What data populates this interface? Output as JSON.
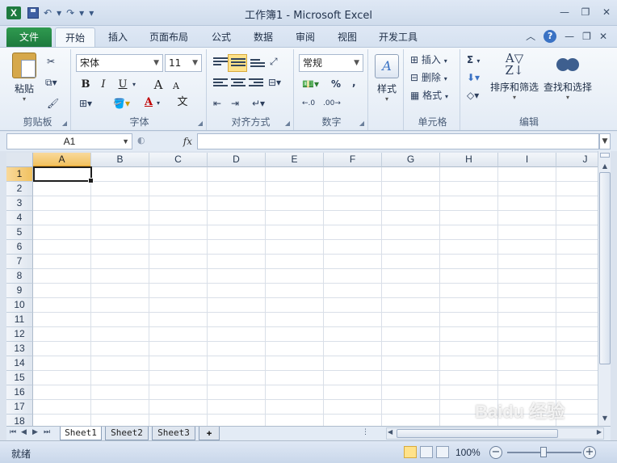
{
  "window": {
    "title": "工作簿1 - Microsoft Excel",
    "app_icon": "X"
  },
  "qat": {
    "undo_icon": "↶",
    "redo_icon": "↷",
    "customize_icon": "▾"
  },
  "tabs": [
    {
      "label": "文件"
    },
    {
      "label": "开始"
    },
    {
      "label": "插入"
    },
    {
      "label": "页面布局"
    },
    {
      "label": "公式"
    },
    {
      "label": "数据"
    },
    {
      "label": "审阅"
    },
    {
      "label": "视图"
    },
    {
      "label": "开发工具"
    }
  ],
  "ribbon": {
    "clipboard": {
      "label": "剪贴板",
      "paste": "粘贴"
    },
    "font": {
      "label": "字体",
      "font_name": "宋体",
      "font_size": "11",
      "bold": "B",
      "italic": "I",
      "underline": "U",
      "grow": "A",
      "shrink": "A",
      "font_color": "A",
      "phonetic": "文"
    },
    "alignment": {
      "label": "对齐方式"
    },
    "number": {
      "label": "数字",
      "format": "常规",
      "percent": "%",
      "comma": ","
    },
    "styles": {
      "label": "样式"
    },
    "cells": {
      "label": "单元格",
      "insert": "插入",
      "delete": "删除",
      "format": "格式"
    },
    "editing": {
      "label": "编辑",
      "sort_filter": "排序和筛选",
      "find_select": "查找和选择",
      "sum": "Σ"
    }
  },
  "formula_bar": {
    "name_box": "A1",
    "fx": "fx",
    "value": ""
  },
  "grid": {
    "columns": [
      "A",
      "B",
      "C",
      "D",
      "E",
      "F",
      "G",
      "H",
      "I",
      "J"
    ],
    "rows": [
      "1",
      "2",
      "3",
      "4",
      "5",
      "6",
      "7",
      "8",
      "9",
      "10",
      "11",
      "12",
      "13",
      "14",
      "15",
      "16",
      "17",
      "18"
    ],
    "selected_cell": "A1"
  },
  "sheets": [
    {
      "name": "Sheet1"
    },
    {
      "name": "Sheet2"
    },
    {
      "name": "Sheet3"
    }
  ],
  "status": {
    "ready": "就绪",
    "zoom": "100%"
  },
  "colors": {
    "file_tab": "#1d7a3e",
    "selection_header": "#f1c15f",
    "accent": "#3a72c4"
  },
  "watermark": "Baidu 经验"
}
